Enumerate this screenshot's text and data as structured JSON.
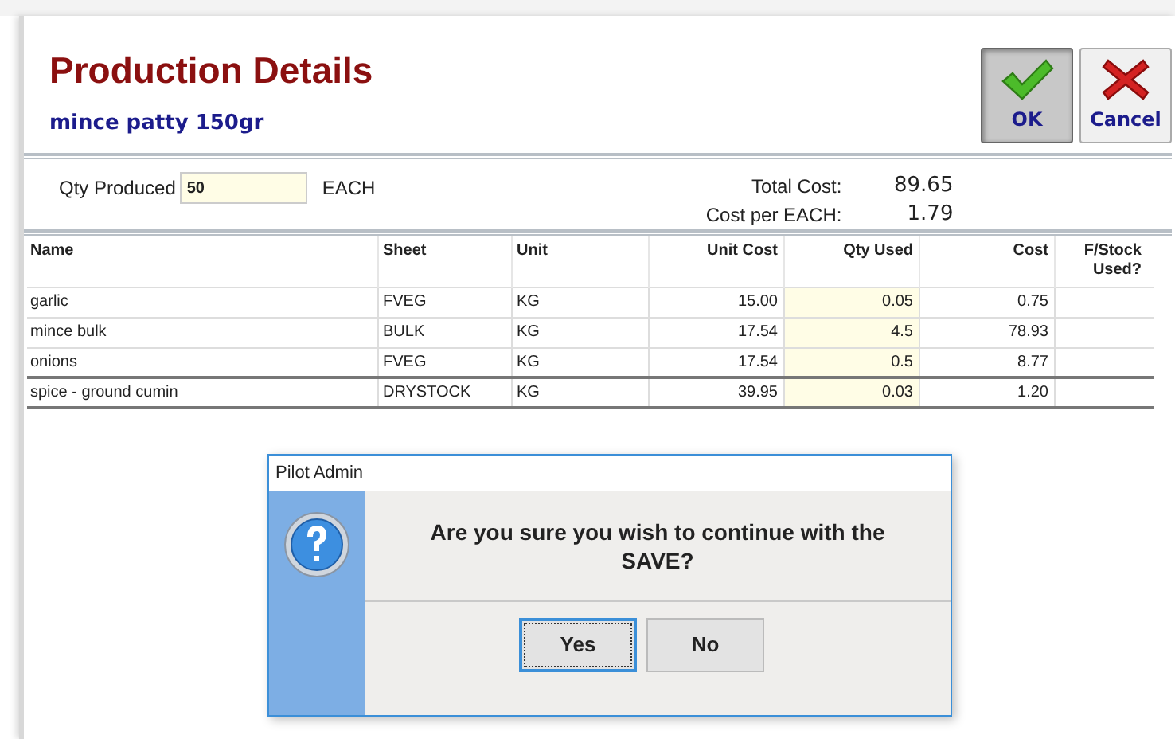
{
  "title": "Production Details",
  "subtitle": "mince patty 150gr",
  "toolbar": [
    {
      "kind": "ok",
      "label": "OK",
      "pressed": true
    },
    {
      "kind": "cancel",
      "label": "Cancel",
      "pressed": false
    }
  ],
  "qty": {
    "label": "Qty Produced",
    "value": "50",
    "unit": "EACH"
  },
  "totals": [
    {
      "label": "Total Cost:",
      "value": "89.65"
    },
    {
      "label": "Cost per EACH:",
      "value": "1.79"
    }
  ],
  "table": {
    "columns": [
      "Name",
      "Sheet",
      "Unit",
      "Unit Cost",
      "Qty Used",
      "Cost",
      "F/Stock Used?"
    ],
    "rows": [
      [
        "garlic",
        "FVEG",
        "KG",
        "15.00",
        "0.05",
        "0.75"
      ],
      [
        "mince bulk",
        "BULK",
        "KG",
        "17.54",
        "4.5",
        "78.93"
      ],
      [
        "onions",
        "FVEG",
        "KG",
        "17.54",
        "0.5",
        "8.77"
      ],
      [
        "spice - ground cumin",
        "DRYSTOCK",
        "KG",
        "39.95",
        "0.03",
        "1.20"
      ]
    ]
  },
  "dialog": {
    "title": "Pilot Admin",
    "message": "Are you sure you wish to continue with the SAVE?",
    "buttons": [
      {
        "label": "Yes",
        "default": true
      },
      {
        "label": "No",
        "default": false
      }
    ]
  }
}
